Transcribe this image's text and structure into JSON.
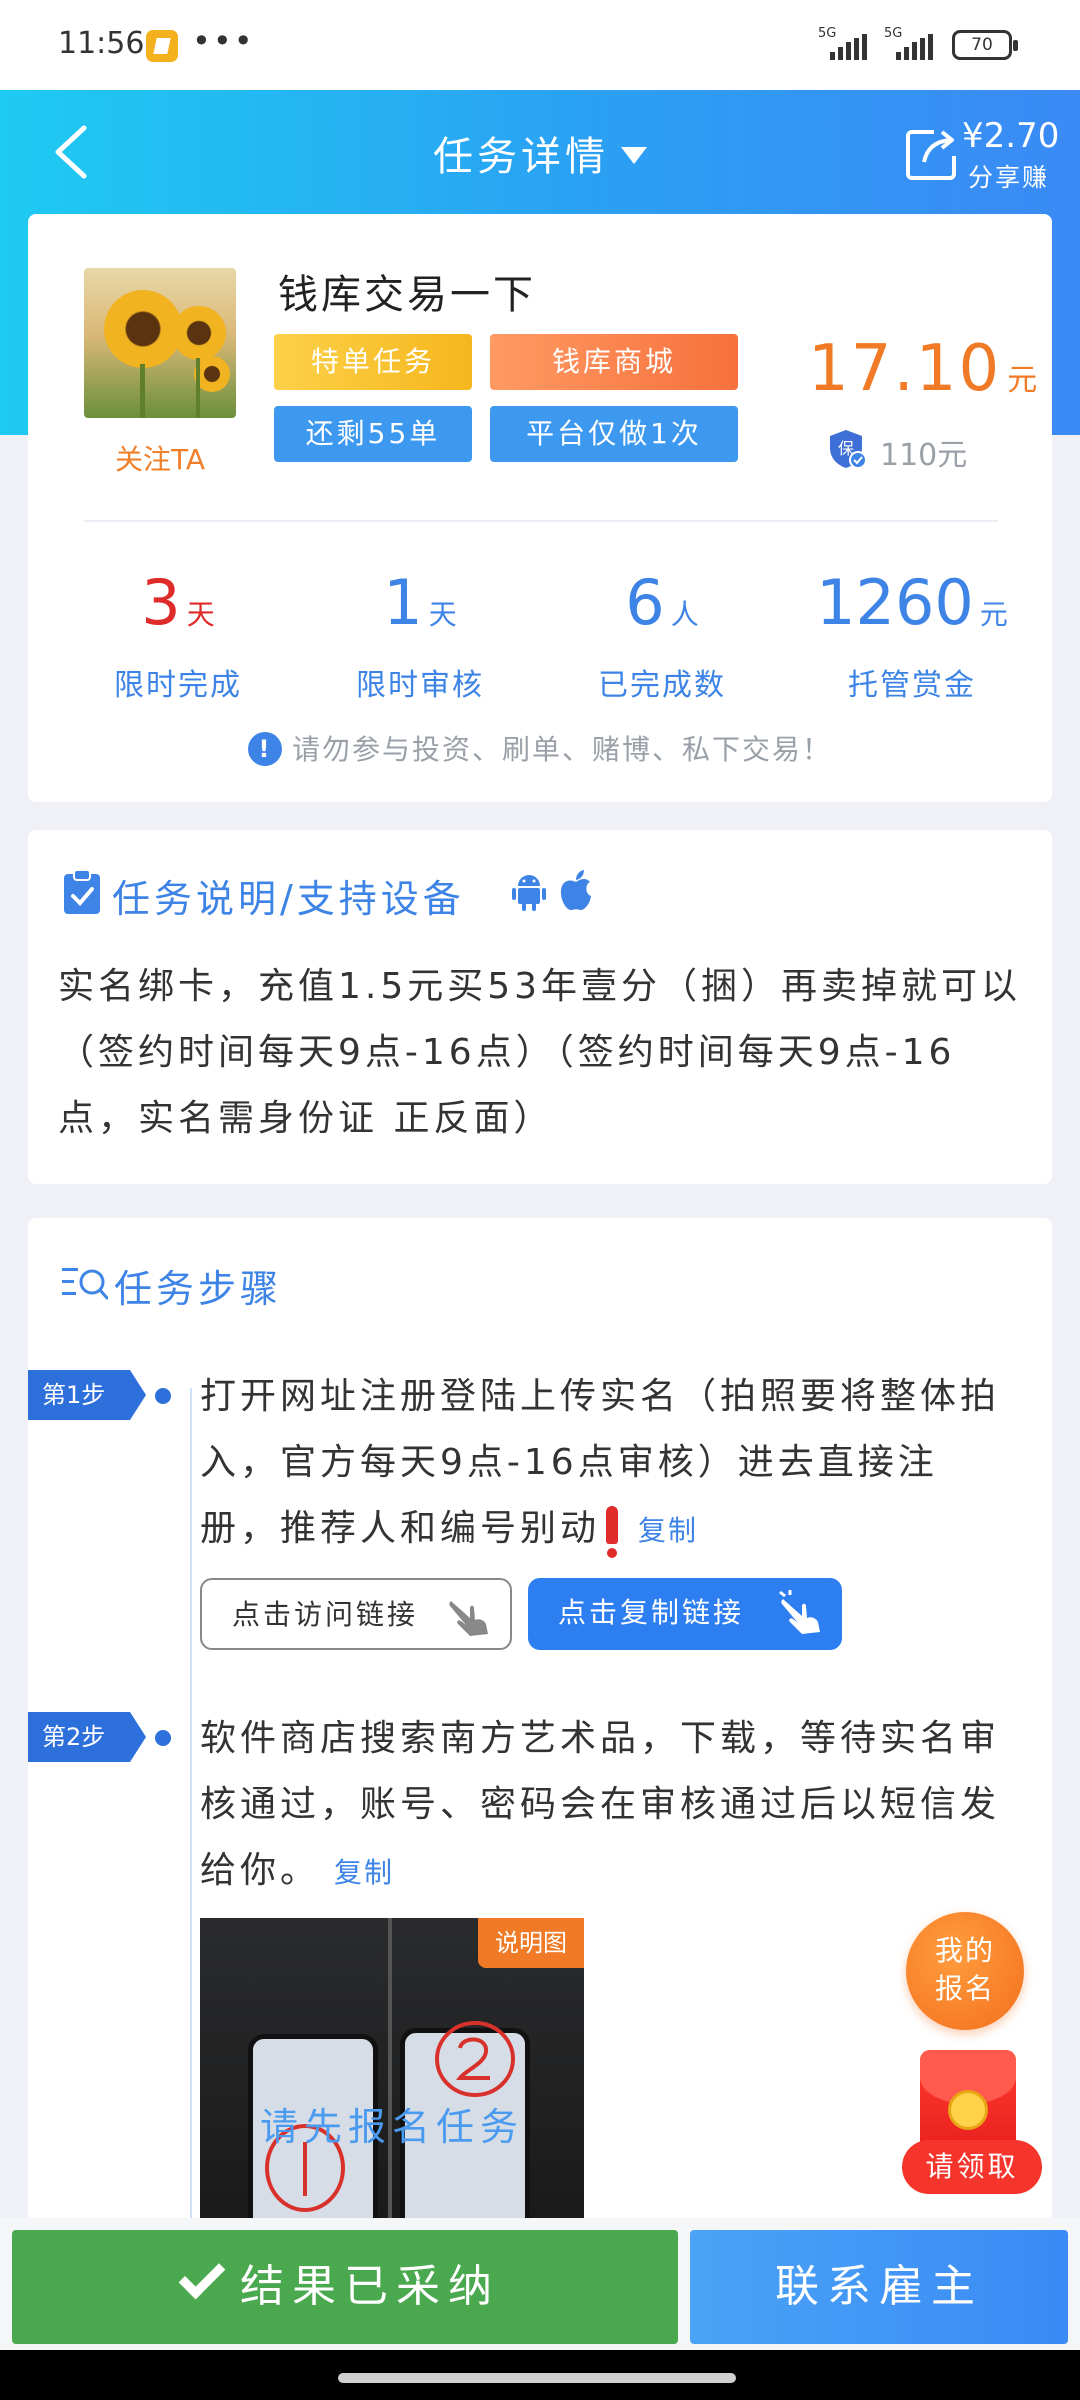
{
  "status_bar": {
    "time": "11:56",
    "more": "•••",
    "signal1": "5G",
    "signal2": "5G",
    "battery": "70"
  },
  "header": {
    "title": "任务详情",
    "share_amount": "¥2.70",
    "share_label": "分享赚"
  },
  "task": {
    "name": "钱库交易一下",
    "follow_label": "关注TA",
    "tags": [
      "特单任务",
      "钱库商城",
      "还剩55单",
      "平台仅做1次"
    ],
    "price": "17.10",
    "price_unit": "元",
    "guarantee": "110元"
  },
  "stats": [
    {
      "value": "3",
      "unit": "天",
      "label": "限时完成"
    },
    {
      "value": "1",
      "unit": "天",
      "label": "限时审核"
    },
    {
      "value": "6",
      "unit": "人",
      "label": "已完成数"
    },
    {
      "value": "1260",
      "unit": "元",
      "label": "托管赏金"
    }
  ],
  "warning": "请勿参与投资、刷单、赌博、私下交易！",
  "description": {
    "title": "任务说明/支持设备",
    "text": "实名绑卡，充值1.5元买53年壹分（捆）再卖掉就可以（签约时间每天9点-16点）（签约时间每天9点-16点，实名需身份证 正反面）"
  },
  "steps": {
    "title": "任务步骤",
    "items": [
      {
        "badge": "第1步",
        "text": "打开网址注册登陆上传实名（拍照要将整体拍入，官方每天9点-16点审核）进去直接注册，推荐人和编号别动",
        "copy": "复制"
      },
      {
        "badge": "第2步",
        "text": "软件商店搜索南方艺术品，下载，等待实名审核通过，账号、密码会在审核通过后以短信发给你。",
        "copy": "复制"
      }
    ],
    "visit_button": "点击访问链接",
    "copy_button": "点击复制链接",
    "image_label": "说明图",
    "image_overlay": "请先报名任务"
  },
  "floating": {
    "my_signup_line1": "我的",
    "my_signup_line2": "报名",
    "redpack_label": "请领取"
  },
  "bottom": {
    "accepted": "结果已采纳",
    "contact": "联系雇主"
  },
  "colors": {
    "accent_blue": "#3d84e6",
    "price_orange": "#f07a26",
    "accepted_green": "#4aa84e"
  }
}
